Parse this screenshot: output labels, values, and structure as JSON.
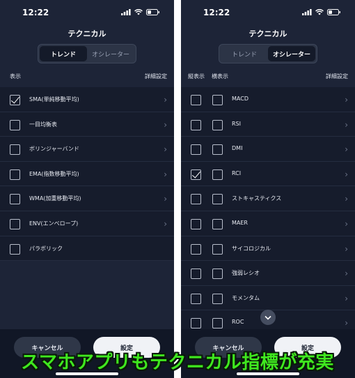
{
  "left": {
    "time": "12:22",
    "title": "テクニカル",
    "tabs": [
      "トレンド",
      "オシレーター"
    ],
    "active_tab": 0,
    "headers": {
      "display": "表示",
      "detail": "詳細設定"
    },
    "items": [
      {
        "label": "SMA(単純移動平均)",
        "checked": true,
        "chevron": true
      },
      {
        "label": "一目均衡表",
        "checked": false,
        "chevron": true
      },
      {
        "label": "ボリンジャーバンド",
        "checked": false,
        "chevron": true
      },
      {
        "label": "EMA(指数移動平均)",
        "checked": false,
        "chevron": true
      },
      {
        "label": "WMA(加重移動平均)",
        "checked": false,
        "chevron": true
      },
      {
        "label": "ENV(エンベロープ)",
        "checked": false,
        "chevron": true
      },
      {
        "label": "パラボリック",
        "checked": false,
        "chevron": false
      }
    ],
    "cancel_label": "キャンセル",
    "settings_label": "設定"
  },
  "right": {
    "time": "12:22",
    "title": "テクニカル",
    "tabs": [
      "トレンド",
      "オシレーター"
    ],
    "active_tab": 1,
    "headers": {
      "vertical": "縦表示",
      "horizontal": "横表示",
      "detail": "詳細設定"
    },
    "items": [
      {
        "label": "MACD",
        "vertical": false,
        "horizontal": false
      },
      {
        "label": "RSI",
        "vertical": false,
        "horizontal": false
      },
      {
        "label": "DMI",
        "vertical": false,
        "horizontal": false
      },
      {
        "label": "RCI",
        "vertical": true,
        "horizontal": false
      },
      {
        "label": "ストキャスティクス",
        "vertical": false,
        "horizontal": false
      },
      {
        "label": "MAER",
        "vertical": false,
        "horizontal": false
      },
      {
        "label": "サイコロジカル",
        "vertical": false,
        "horizontal": false
      },
      {
        "label": "強弱レシオ",
        "vertical": false,
        "horizontal": false
      },
      {
        "label": "モメンタム",
        "vertical": false,
        "horizontal": false
      },
      {
        "label": "ROC",
        "vertical": false,
        "horizontal": false
      }
    ],
    "cancel_label": "キャンセル",
    "settings_label": "設定"
  },
  "caption": "スマホアプリもテクニカル指標が充実",
  "colors": {
    "caption": "#3fe81f",
    "background": "#1d2437"
  }
}
